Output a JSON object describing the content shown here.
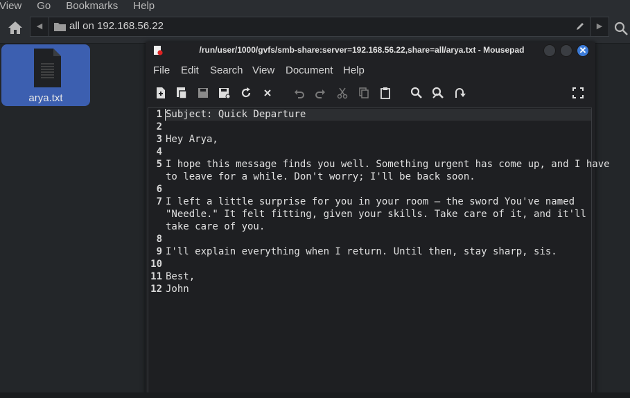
{
  "fm_menu": [
    "View",
    "Go",
    "Bookmarks",
    "Help"
  ],
  "location": {
    "path_text": "all on 192.168.56.22"
  },
  "file": {
    "name": "arya.txt"
  },
  "mousepad": {
    "title": "/run/user/1000/gvfs/smb-share:server=192.168.56.22,share=all/arya.txt - Mousepad",
    "menu": [
      "File",
      "Edit",
      "Search",
      "View",
      "Document",
      "Help"
    ],
    "close_glyph": "✕"
  },
  "editor": {
    "lines": [
      {
        "num": "1",
        "rows": [
          "Subject: Quick Departure"
        ]
      },
      {
        "num": "2",
        "rows": [
          ""
        ]
      },
      {
        "num": "3",
        "rows": [
          "Hey Arya,"
        ]
      },
      {
        "num": "4",
        "rows": [
          ""
        ]
      },
      {
        "num": "5",
        "rows": [
          "I hope this message finds you well. Something urgent has come up, and I have",
          "to leave for a while. Don't worry; I'll be back soon."
        ]
      },
      {
        "num": "6",
        "rows": [
          ""
        ]
      },
      {
        "num": "7",
        "rows": [
          "I left a little surprise for you in your room — the sword You've named",
          "\"Needle.\" It felt fitting, given your skills. Take care of it, and it'll",
          "take care of you."
        ]
      },
      {
        "num": "8",
        "rows": [
          ""
        ]
      },
      {
        "num": "9",
        "rows": [
          "I'll explain everything when I return. Until then, stay sharp, sis."
        ]
      },
      {
        "num": "10",
        "rows": [
          ""
        ]
      },
      {
        "num": "11",
        "rows": [
          "Best,"
        ]
      },
      {
        "num": "12",
        "rows": [
          "John"
        ]
      }
    ]
  },
  "colors": {
    "accent": "#3c5fb0",
    "close_button": "#3c7bd8",
    "background": "#232629"
  },
  "icons": [
    "home-icon",
    "folder-icon",
    "edit-location-icon",
    "search-icon",
    "text-file-icon",
    "new-document-icon",
    "new-window-icon",
    "save-icon",
    "save-as-icon",
    "reload-icon",
    "close-document-icon",
    "undo-icon",
    "redo-icon",
    "cut-icon",
    "copy-icon",
    "paste-icon",
    "find-icon",
    "find-replace-icon",
    "goto-icon",
    "fullscreen-icon"
  ]
}
